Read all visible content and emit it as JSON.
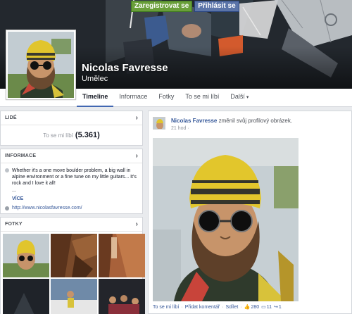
{
  "auth": {
    "register_label": "Zaregistrovat se",
    "login_label": "Přihlásit se"
  },
  "profile": {
    "name": "Nicolas Favresse",
    "category": "Umělec"
  },
  "nav": {
    "tabs": [
      {
        "label": "Timeline",
        "active": true
      },
      {
        "label": "Informace"
      },
      {
        "label": "Fotky"
      },
      {
        "label": "To se mi líbí"
      },
      {
        "label": "Další"
      }
    ]
  },
  "people": {
    "title": "LIDÉ",
    "likes_label": "To se mi líbí",
    "likes_count": "(5.361)"
  },
  "about": {
    "title": "INFORMACE",
    "description": "Whether it's a one move boulder problem, a big wall in alpine environment or a fine tune on my little guitars... It's rock and I love it all!",
    "ellipsis": "...",
    "more_label": "VÍCE",
    "website": "http://www.nicolasfavresse.com/"
  },
  "photos": {
    "title": "FOTKY"
  },
  "post": {
    "author": "Nicolas Favresse",
    "action": "změnil svůj profilový obrázek.",
    "time": "21 hod",
    "like_label": "To se mi líbí",
    "comment_label": "Přidat komentář",
    "share_label": "Sdílet",
    "likes_count": "280",
    "comments_count": "11",
    "shares_count": "1"
  },
  "icons": [
    "chevron-right-icon",
    "info-bubble-icon",
    "globe-icon",
    "thumb-up-icon",
    "comment-icon",
    "share-icon",
    "globe-small-icon"
  ],
  "colors": {
    "accent": "#4267b2",
    "link": "#365899",
    "register": "#6a9f3a",
    "login": "#5b74a8"
  }
}
